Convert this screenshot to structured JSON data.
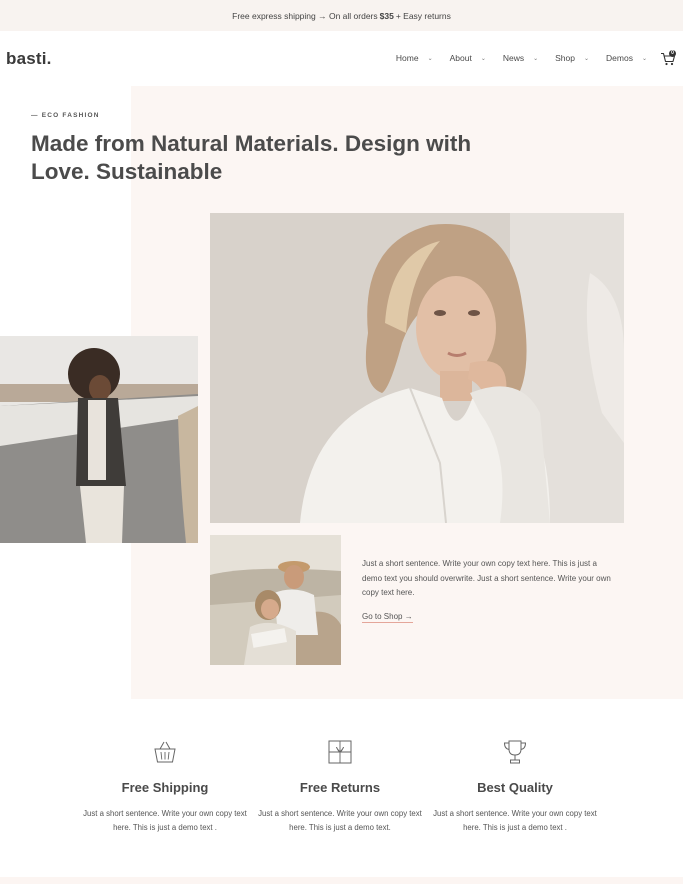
{
  "topbar": {
    "text_before": "Free express shipping → On all orders",
    "amount": "$35",
    "text_after": "+ Easy returns"
  },
  "header": {
    "logo": "basti.",
    "nav": [
      {
        "label": "Home"
      },
      {
        "label": "About"
      },
      {
        "label": "News"
      },
      {
        "label": "Shop"
      },
      {
        "label": "Demos"
      }
    ],
    "cart_count": "0",
    "cart_icon": "cart-icon",
    "chevron_icon": "chevron-down-icon"
  },
  "hero": {
    "eyebrow": "— ECO FASHION",
    "headline": "Made from Natural Materials. Design with Love. Sustainable",
    "body": "Just a short sentence. Write your own copy text here. This is just a demo text you should overwrite. Just a short sentence. Write your own copy text here.",
    "link": "Go to Shop →",
    "link_underline_color": "#e4a69a",
    "background_color": "#fcf6f3"
  },
  "features": [
    {
      "icon": "basket-icon",
      "title": "Free Shipping",
      "text": "Just a short sentence. Write your own copy text here.  This is just a demo text ."
    },
    {
      "icon": "gift-box-icon",
      "title": "Free Returns",
      "text": "Just a short sentence. Write your own copy text here.  This is just a demo text."
    },
    {
      "icon": "trophy-icon",
      "title": "Best Quality",
      "text": "Just a short sentence. Write your own copy text here.  This is just a demo text ."
    }
  ],
  "colors": {
    "topbar_bg": "#f8f3f0",
    "text": "#4a4a4a"
  }
}
